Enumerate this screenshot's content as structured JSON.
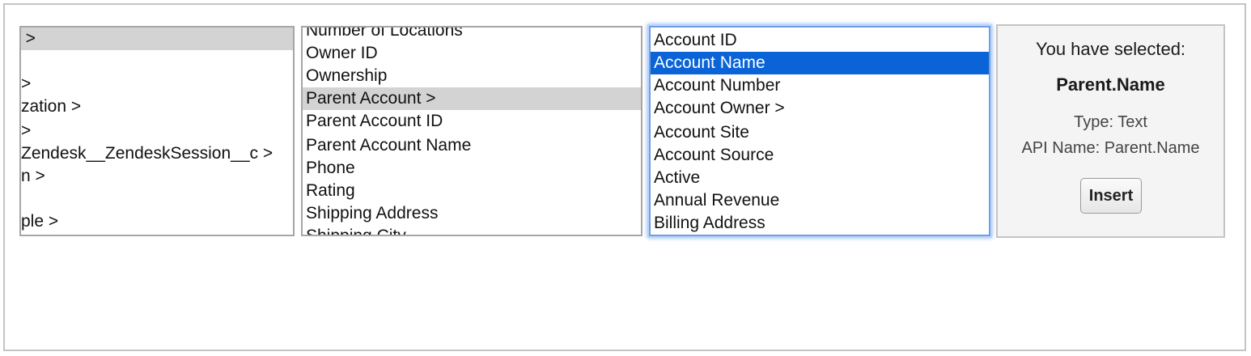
{
  "list1": {
    "items": [
      {
        "label": "t >",
        "highlighted": true
      },
      {
        "label": ""
      },
      {
        "label": ">"
      },
      {
        "label": "zation >"
      },
      {
        "label": " >"
      },
      {
        "label": "Zendesk__ZendeskSession__c >"
      },
      {
        "label": "n >"
      },
      {
        "label": ""
      },
      {
        "label": "ple >"
      }
    ]
  },
  "list2": {
    "items": [
      {
        "label": "Number of Locations"
      },
      {
        "label": "Owner ID"
      },
      {
        "label": "Ownership"
      },
      {
        "label": "Parent Account >",
        "highlighted": true
      },
      {
        "label": "Parent Account ID"
      },
      {
        "label": "Parent Account Name"
      },
      {
        "label": "Phone"
      },
      {
        "label": "Rating"
      },
      {
        "label": "Shipping Address"
      },
      {
        "label": "Shipping City"
      }
    ]
  },
  "list3": {
    "items": [
      {
        "label": "Account ID"
      },
      {
        "label": "Account Name",
        "selected": true
      },
      {
        "label": "Account Number"
      },
      {
        "label": "Account Owner >"
      },
      {
        "label": "Account Site"
      },
      {
        "label": "Account Source"
      },
      {
        "label": "Active"
      },
      {
        "label": "Annual Revenue"
      },
      {
        "label": "Billing Address"
      }
    ]
  },
  "info": {
    "heading": "You have selected:",
    "name": "Parent.Name",
    "type_line": "Type: Text",
    "api_line": "API Name: Parent.Name",
    "insert_label": "Insert"
  },
  "colors": {
    "selected_bg": "#0a64d7",
    "highlight_bg": "#d3d3d3",
    "focus_ring": "#6b9ee8"
  }
}
